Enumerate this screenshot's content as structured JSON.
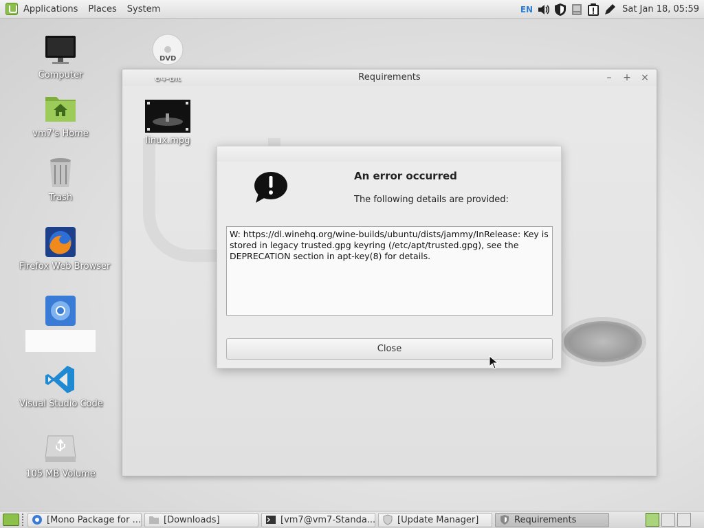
{
  "top_panel": {
    "menus": [
      "Applications",
      "Places",
      "System"
    ],
    "tray_language": "EN",
    "clock": "Sat Jan 18, 05:59"
  },
  "desktop": {
    "icons": [
      {
        "label": "Computer",
        "icon": "computer-icon"
      },
      {
        "label": "vm7's Home",
        "icon": "home-folder-icon"
      },
      {
        "label": "Trash",
        "icon": "trash-icon"
      },
      {
        "label": "Firefox Web Browser",
        "icon": "firefox-icon"
      },
      {
        "label": "",
        "icon": "chromium-icon"
      },
      {
        "label": "Visual Studio Code",
        "icon": "vscode-icon"
      },
      {
        "label": "105 MB Volume",
        "icon": "usb-drive-icon"
      },
      {
        "label": "64-bit",
        "icon": "dvd-icon"
      },
      {
        "label": "linux.mpg",
        "icon": "video-file-icon"
      }
    ]
  },
  "requirements_window": {
    "title": "Requirements",
    "controls": [
      "–",
      "+",
      "×"
    ]
  },
  "error_dialog": {
    "title": "An error occurred",
    "subtitle": "The following details are provided:",
    "details": "W: https://dl.winehq.org/wine-builds/ubuntu/dists/jammy/InRelease: Key is stored in legacy trusted.gpg keyring (/etc/apt/trusted.gpg), see the DEPRECATION section in apt-key(8) for details.",
    "close_label": "Close"
  },
  "taskbar": {
    "tasks": [
      {
        "label": "[Mono Package for ...",
        "icon": "chromium-icon"
      },
      {
        "label": "[Downloads]",
        "icon": "folder-icon"
      },
      {
        "label": "[vm7@vm7-Standa...",
        "icon": "terminal-icon"
      },
      {
        "label": "[Update Manager]",
        "icon": "update-manager-icon"
      },
      {
        "label": "Requirements",
        "icon": "shield-icon",
        "active": true
      }
    ]
  },
  "colors": {
    "mint_green": "#8dc04b",
    "accent_blue": "#2f7fd0"
  }
}
